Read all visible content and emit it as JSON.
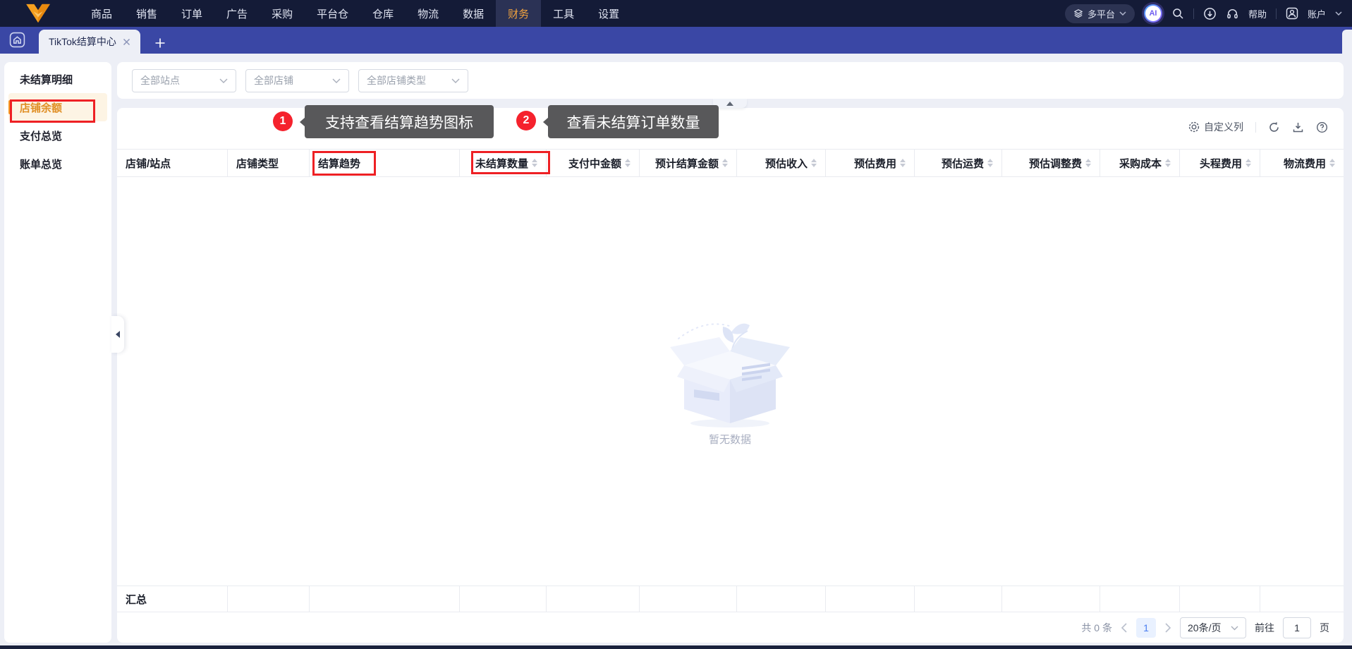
{
  "topbar": {
    "items": [
      "商品",
      "销售",
      "订单",
      "广告",
      "采购",
      "平台仓",
      "仓库",
      "物流",
      "数据",
      "财务",
      "工具",
      "设置"
    ],
    "active_item": "财务",
    "platform_selector": "多平台",
    "ai_badge": "AI",
    "help_label": "帮助",
    "account_label": "账户"
  },
  "tabbar": {
    "active_tab": "TikTok结算中心"
  },
  "sidebar": {
    "items": [
      {
        "label": "未结算明细",
        "active": false
      },
      {
        "label": "店铺余额",
        "active": true
      },
      {
        "label": "支付总览",
        "active": false
      },
      {
        "label": "账单总览",
        "active": false
      }
    ]
  },
  "filters": [
    {
      "value": "全部站点"
    },
    {
      "value": "全部店铺"
    },
    {
      "value": "全部店铺类型"
    }
  ],
  "toolbar": {
    "customize_columns": "自定义列"
  },
  "table": {
    "columns": [
      {
        "label": "店铺/站点",
        "sortable": false
      },
      {
        "label": "店铺类型",
        "sortable": false
      },
      {
        "label": "结算趋势",
        "sortable": false
      },
      {
        "label": "未结算数量",
        "sortable": true
      },
      {
        "label": "支付中金额",
        "sortable": true
      },
      {
        "label": "预计结算金额",
        "sortable": true
      },
      {
        "label": "预估收入",
        "sortable": true
      },
      {
        "label": "预估费用",
        "sortable": true
      },
      {
        "label": "预估运费",
        "sortable": true
      },
      {
        "label": "预估调整费",
        "sortable": true
      },
      {
        "label": "采购成本",
        "sortable": true
      },
      {
        "label": "头程费用",
        "sortable": true
      },
      {
        "label": "物流费用",
        "sortable": true
      }
    ],
    "rows": [],
    "empty_text": "暂无数据",
    "summary_label": "汇总"
  },
  "annotations": {
    "callouts": [
      {
        "number": "1",
        "text": "支持查看结算趋势图标",
        "target": "结算趋势"
      },
      {
        "number": "2",
        "text": "查看未结算订单数量",
        "target": "未结算数量"
      }
    ],
    "highlight_color": "#ee2024",
    "badge_color": "#f5222d",
    "tooltip_bg": "#58585a"
  },
  "pagination": {
    "total_text": "共 0 条",
    "current_page": "1",
    "page_size": "20条/页",
    "goto_label": "前往",
    "goto_value": "1",
    "page_unit": "页"
  },
  "colors": {
    "accent_orange": "#f59a23",
    "topbar_bg": "#141b37",
    "tabbar_bg": "#3a47a5",
    "active_nav_text": "#f2a33d",
    "active_page_blue": "#4a7df0"
  }
}
